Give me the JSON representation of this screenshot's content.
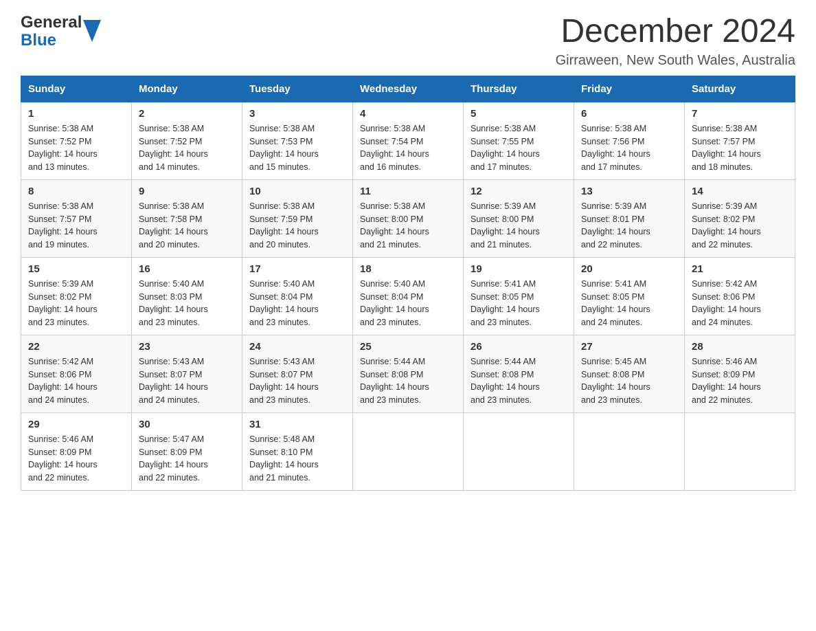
{
  "header": {
    "logo_general": "General",
    "logo_blue": "Blue",
    "month_title": "December 2024",
    "location": "Girraween, New South Wales, Australia"
  },
  "days_of_week": [
    "Sunday",
    "Monday",
    "Tuesday",
    "Wednesday",
    "Thursday",
    "Friday",
    "Saturday"
  ],
  "weeks": [
    [
      {
        "day": "1",
        "sunrise": "5:38 AM",
        "sunset": "7:52 PM",
        "daylight": "14 hours and 13 minutes."
      },
      {
        "day": "2",
        "sunrise": "5:38 AM",
        "sunset": "7:52 PM",
        "daylight": "14 hours and 14 minutes."
      },
      {
        "day": "3",
        "sunrise": "5:38 AM",
        "sunset": "7:53 PM",
        "daylight": "14 hours and 15 minutes."
      },
      {
        "day": "4",
        "sunrise": "5:38 AM",
        "sunset": "7:54 PM",
        "daylight": "14 hours and 16 minutes."
      },
      {
        "day": "5",
        "sunrise": "5:38 AM",
        "sunset": "7:55 PM",
        "daylight": "14 hours and 17 minutes."
      },
      {
        "day": "6",
        "sunrise": "5:38 AM",
        "sunset": "7:56 PM",
        "daylight": "14 hours and 17 minutes."
      },
      {
        "day": "7",
        "sunrise": "5:38 AM",
        "sunset": "7:57 PM",
        "daylight": "14 hours and 18 minutes."
      }
    ],
    [
      {
        "day": "8",
        "sunrise": "5:38 AM",
        "sunset": "7:57 PM",
        "daylight": "14 hours and 19 minutes."
      },
      {
        "day": "9",
        "sunrise": "5:38 AM",
        "sunset": "7:58 PM",
        "daylight": "14 hours and 20 minutes."
      },
      {
        "day": "10",
        "sunrise": "5:38 AM",
        "sunset": "7:59 PM",
        "daylight": "14 hours and 20 minutes."
      },
      {
        "day": "11",
        "sunrise": "5:38 AM",
        "sunset": "8:00 PM",
        "daylight": "14 hours and 21 minutes."
      },
      {
        "day": "12",
        "sunrise": "5:39 AM",
        "sunset": "8:00 PM",
        "daylight": "14 hours and 21 minutes."
      },
      {
        "day": "13",
        "sunrise": "5:39 AM",
        "sunset": "8:01 PM",
        "daylight": "14 hours and 22 minutes."
      },
      {
        "day": "14",
        "sunrise": "5:39 AM",
        "sunset": "8:02 PM",
        "daylight": "14 hours and 22 minutes."
      }
    ],
    [
      {
        "day": "15",
        "sunrise": "5:39 AM",
        "sunset": "8:02 PM",
        "daylight": "14 hours and 23 minutes."
      },
      {
        "day": "16",
        "sunrise": "5:40 AM",
        "sunset": "8:03 PM",
        "daylight": "14 hours and 23 minutes."
      },
      {
        "day": "17",
        "sunrise": "5:40 AM",
        "sunset": "8:04 PM",
        "daylight": "14 hours and 23 minutes."
      },
      {
        "day": "18",
        "sunrise": "5:40 AM",
        "sunset": "8:04 PM",
        "daylight": "14 hours and 23 minutes."
      },
      {
        "day": "19",
        "sunrise": "5:41 AM",
        "sunset": "8:05 PM",
        "daylight": "14 hours and 23 minutes."
      },
      {
        "day": "20",
        "sunrise": "5:41 AM",
        "sunset": "8:05 PM",
        "daylight": "14 hours and 24 minutes."
      },
      {
        "day": "21",
        "sunrise": "5:42 AM",
        "sunset": "8:06 PM",
        "daylight": "14 hours and 24 minutes."
      }
    ],
    [
      {
        "day": "22",
        "sunrise": "5:42 AM",
        "sunset": "8:06 PM",
        "daylight": "14 hours and 24 minutes."
      },
      {
        "day": "23",
        "sunrise": "5:43 AM",
        "sunset": "8:07 PM",
        "daylight": "14 hours and 24 minutes."
      },
      {
        "day": "24",
        "sunrise": "5:43 AM",
        "sunset": "8:07 PM",
        "daylight": "14 hours and 23 minutes."
      },
      {
        "day": "25",
        "sunrise": "5:44 AM",
        "sunset": "8:08 PM",
        "daylight": "14 hours and 23 minutes."
      },
      {
        "day": "26",
        "sunrise": "5:44 AM",
        "sunset": "8:08 PM",
        "daylight": "14 hours and 23 minutes."
      },
      {
        "day": "27",
        "sunrise": "5:45 AM",
        "sunset": "8:08 PM",
        "daylight": "14 hours and 23 minutes."
      },
      {
        "day": "28",
        "sunrise": "5:46 AM",
        "sunset": "8:09 PM",
        "daylight": "14 hours and 22 minutes."
      }
    ],
    [
      {
        "day": "29",
        "sunrise": "5:46 AM",
        "sunset": "8:09 PM",
        "daylight": "14 hours and 22 minutes."
      },
      {
        "day": "30",
        "sunrise": "5:47 AM",
        "sunset": "8:09 PM",
        "daylight": "14 hours and 22 minutes."
      },
      {
        "day": "31",
        "sunrise": "5:48 AM",
        "sunset": "8:10 PM",
        "daylight": "14 hours and 21 minutes."
      },
      null,
      null,
      null,
      null
    ]
  ],
  "labels": {
    "sunrise": "Sunrise:",
    "sunset": "Sunset:",
    "daylight": "Daylight:"
  }
}
